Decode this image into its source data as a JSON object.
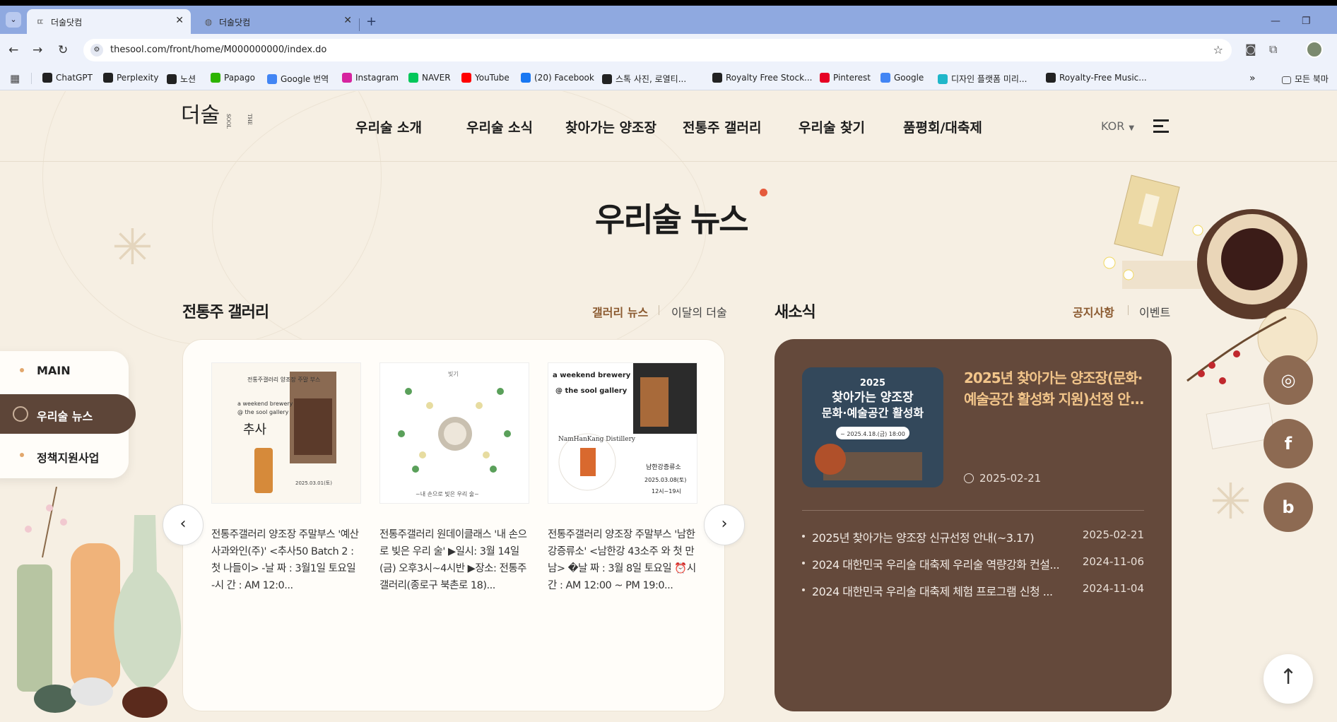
{
  "browser": {
    "tabs": [
      {
        "title": "더술닷컴",
        "active": true
      },
      {
        "title": "더술닷컴",
        "active": false
      }
    ],
    "url": "thesool.com/front/home/M000000000/index.do",
    "bookmarks": [
      {
        "label": "ChatGPT",
        "icon": "chatgpt-icon",
        "color": "#222222"
      },
      {
        "label": "Perplexity",
        "icon": "perplexity-icon",
        "color": "#222222"
      },
      {
        "label": "노션",
        "icon": "notion-icon",
        "color": "#222222"
      },
      {
        "label": "Papago",
        "icon": "papago-icon",
        "color": "#2db400"
      },
      {
        "label": "Google 번역",
        "icon": "google-translate-icon",
        "color": "#4285f4"
      },
      {
        "label": "Instagram",
        "icon": "instagram-icon",
        "color": "#d6249f"
      },
      {
        "label": "NAVER",
        "icon": "naver-icon",
        "color": "#03c75a"
      },
      {
        "label": "YouTube",
        "icon": "youtube-icon",
        "color": "#ff0000"
      },
      {
        "label": "(20) Facebook",
        "icon": "facebook-icon",
        "color": "#1877f2"
      },
      {
        "label": "스톡 사진, 로열티...",
        "icon": "shutterstock-icon",
        "color": "#222222"
      },
      {
        "label": "Royalty Free Stock...",
        "icon": "stock-icon",
        "color": "#222222"
      },
      {
        "label": "Pinterest",
        "icon": "pinterest-icon",
        "color": "#e60023"
      },
      {
        "label": "Google",
        "icon": "google-icon",
        "color": "#4285f4"
      },
      {
        "label": "디자인 플랫폼 미리...",
        "icon": "miricanvas-icon",
        "color": "#1fb6c9"
      },
      {
        "label": "Royalty-Free Music...",
        "icon": "music-icon",
        "color": "#222222"
      }
    ],
    "all_bookmarks": "모든 북마"
  },
  "header": {
    "logo": "더술",
    "logo_sub": "THE SOOL",
    "nav": [
      "우리술 소개",
      "우리술 소식",
      "찾아가는 양조장",
      "전통주 갤러리",
      "우리술 찾기",
      "품평회/대축제"
    ],
    "lang": "KOR"
  },
  "section_title": "우리술 뉴스",
  "quick_menu": [
    "MAIN",
    "우리술 뉴스",
    "정책지원사업"
  ],
  "gallery": {
    "heading": "전통주 갤러리",
    "tab_active": "갤러리 뉴스",
    "tab_other": "이달의 더술",
    "cards": [
      {
        "caption": " 전통주갤러리 양조장 주말부스 '예산사과와인(주)' <추사50 Batch 2 : 첫 나들이> -날 짜 : 3월1일 토요일 -시 간 : AM 12:0..."
      },
      {
        "caption": "전통주갤러리 원데이클래스 '내 손으로 빚은 우리 술' ▶일시: 3월 14일(금) 오후3시~4시반 ▶장소: 전통주갤러리(종로구 북촌로 18)..."
      },
      {
        "caption": " 전통주갤러리 양조장 주말부스 '남한강증류소' <남한강 43소주 와 첫 만남> �날 짜 : 3월 8일 토요일 ⏰시 간 : AM 12:00 ~ PM 19:0..."
      }
    ],
    "thumb_texts": {
      "card1_top": "전통주갤러리 양조장 주말 부스",
      "card1_mid1": "a weekend brewery",
      "card1_mid2": "@ the sool gallery",
      "card1_brand": "추사",
      "card1_date": "2025.03.01(토)",
      "card2_top": "빚기",
      "card2_bottom": "~내 손으로 빚은 우리 술~",
      "card3_t1": "a weekend brewery",
      "card3_t2": "@ the sool gallery",
      "card3_name": "남한강증류소",
      "card3_date": "2025.03.08(토)",
      "card3_time": "12시~19시",
      "card3_logo": "NamHanKang Distillery"
    }
  },
  "news": {
    "heading": "새소식",
    "tab_active": "공지사항",
    "tab_other": "이벤트",
    "feature": {
      "img_year": "2025",
      "img_title1": "찾아가는 양조장",
      "img_title2": "문화·예술공간 활성화",
      "img_date": "~ 2025.4.18.(금) 18:00",
      "title": "2025년 찾아가는 양조장(문화·예술공간 활성화 지원)선정 안...",
      "date": "2025-02-21"
    },
    "items": [
      {
        "title": "2025년 찾아가는 양조장 신규선정 안내(~3.17)",
        "date": "2025-02-21"
      },
      {
        "title": "2024 대한민국 우리술 대축제 우리술 역량강화 컨설...",
        "date": "2024-11-06"
      },
      {
        "title": "2024 대한민국 우리술 대축제 체험 프로그램 신청 ...",
        "date": "2024-11-04"
      }
    ]
  },
  "sns": [
    {
      "label": "instagram",
      "glyph": "◎"
    },
    {
      "label": "facebook",
      "glyph": "f"
    },
    {
      "label": "blog",
      "glyph": "b"
    }
  ],
  "top_button": "↑"
}
